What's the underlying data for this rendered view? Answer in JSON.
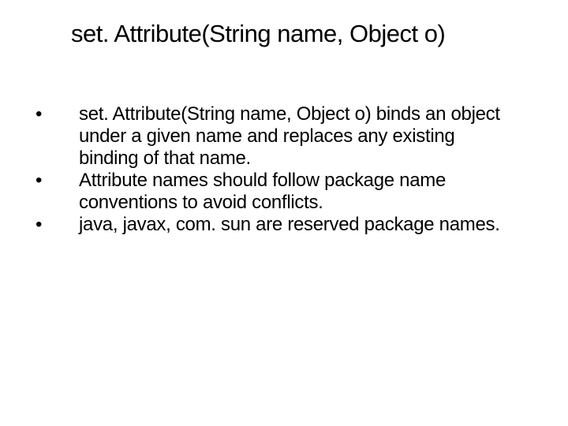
{
  "slide": {
    "title": "set. Attribute(String name, Object o)",
    "bullets": [
      {
        "marker": "•",
        "text": "set. Attribute(String name, Object o) binds an object under a given name and replaces any existing binding of that name."
      },
      {
        "marker": "•",
        "text": "Attribute names should follow package name conventions to avoid conflicts."
      },
      {
        "marker": "•",
        "text": "java, javax, com. sun are reserved package names."
      }
    ]
  }
}
